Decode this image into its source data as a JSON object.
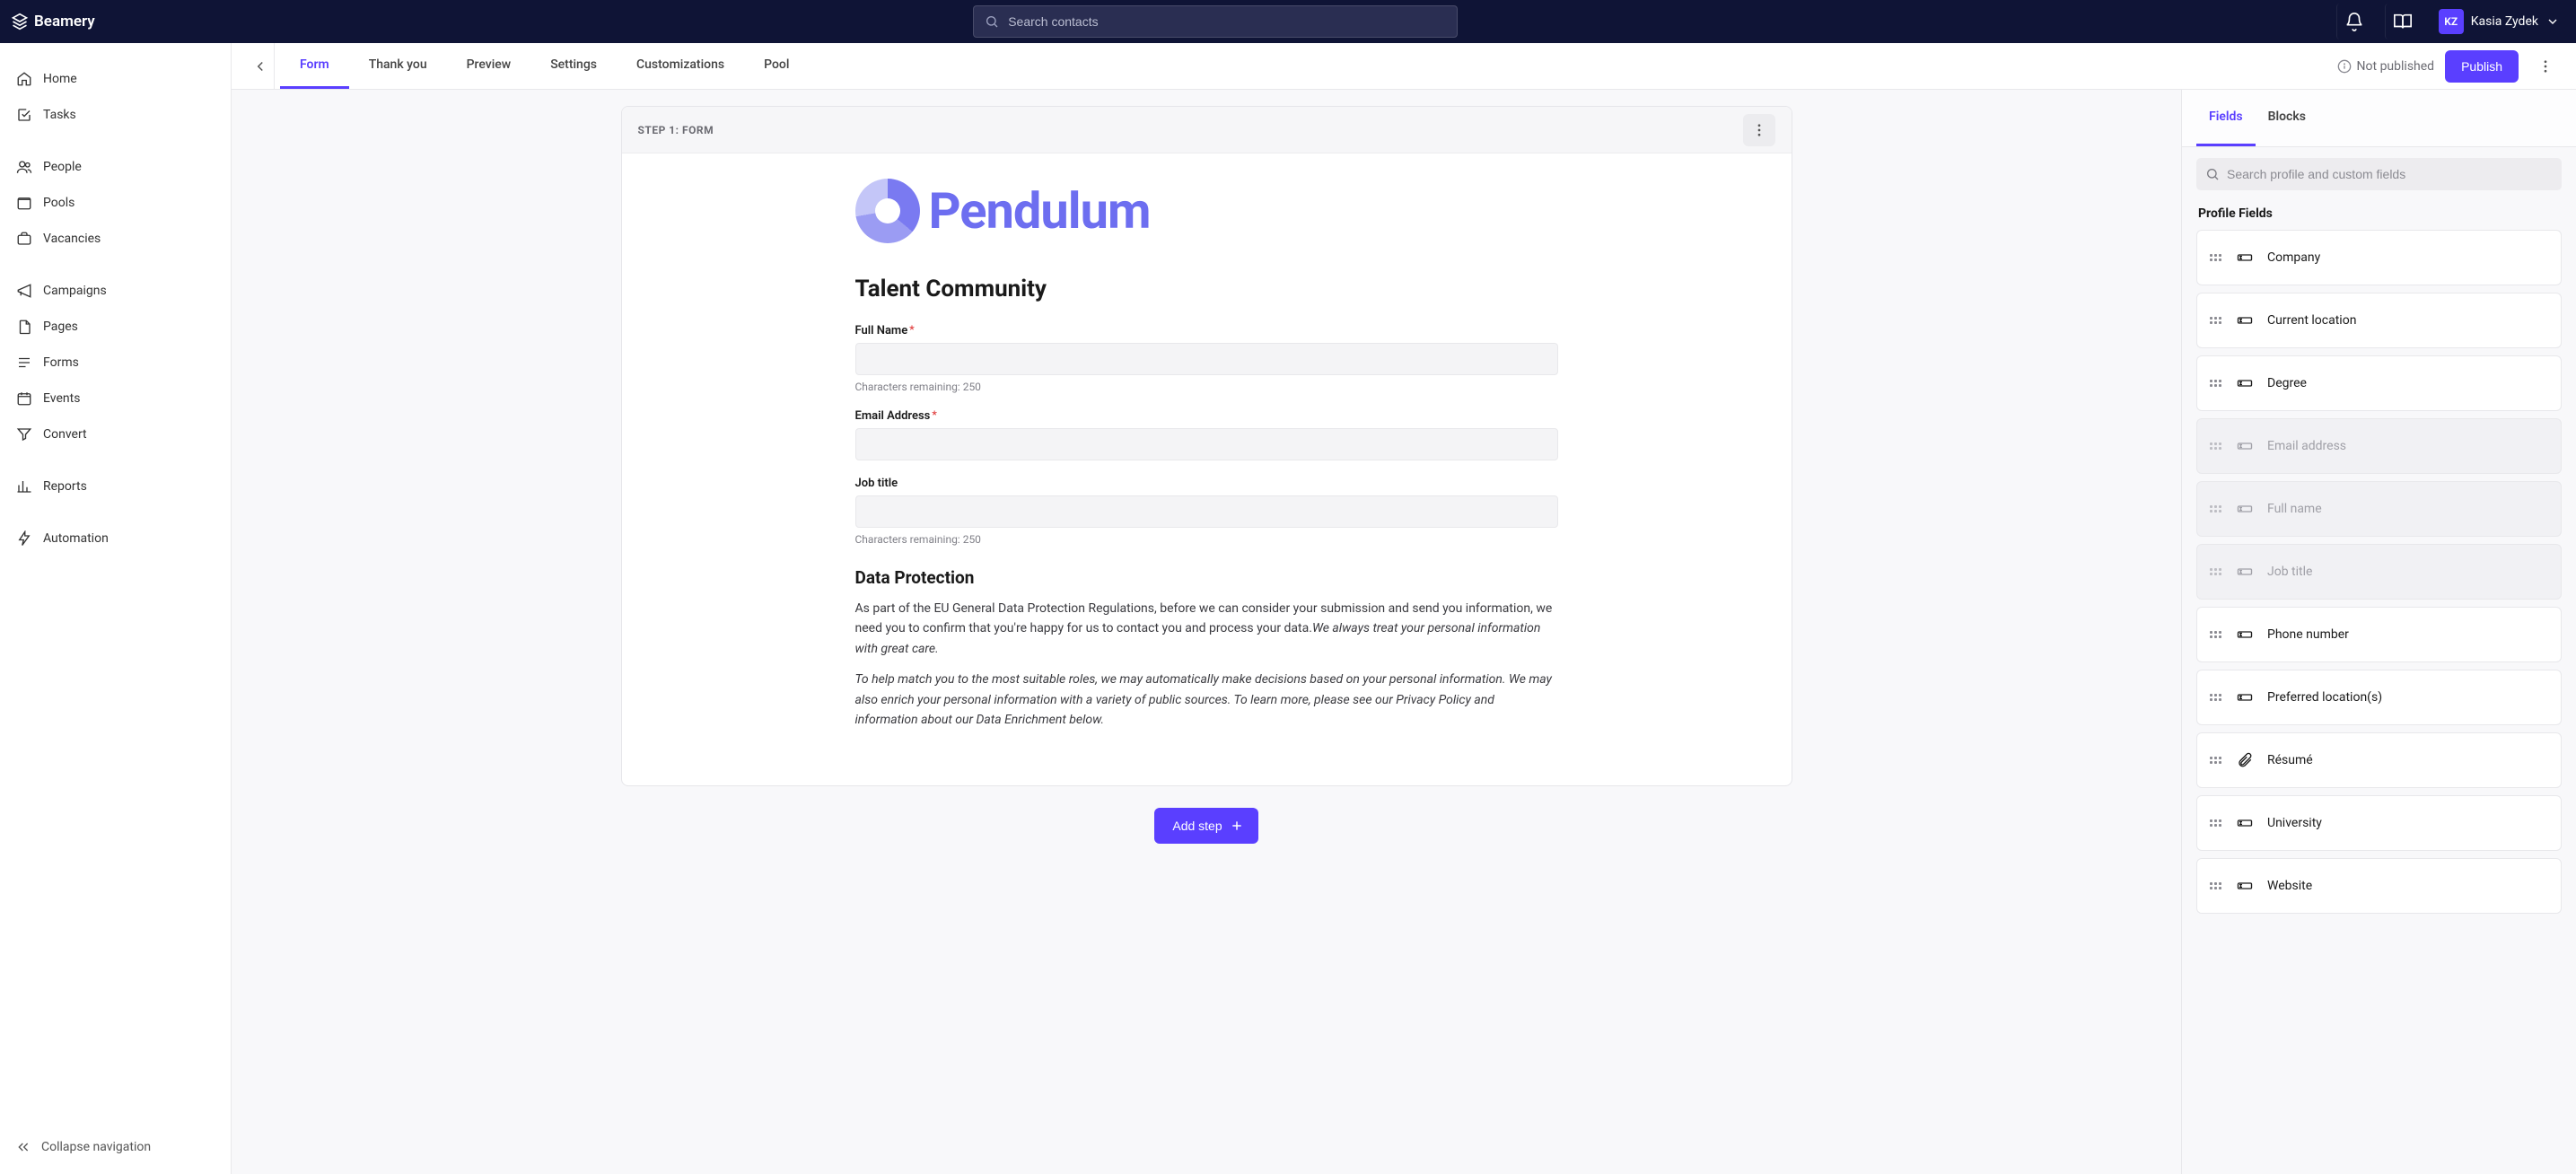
{
  "header": {
    "brand": "Beamery",
    "search_placeholder": "Search contacts",
    "user_initials": "KZ",
    "user_name": "Kasia Zydek"
  },
  "sidebar": {
    "items": [
      {
        "id": "home",
        "label": "Home"
      },
      {
        "id": "tasks",
        "label": "Tasks"
      },
      {
        "id": "people",
        "label": "People"
      },
      {
        "id": "pools",
        "label": "Pools"
      },
      {
        "id": "vacancies",
        "label": "Vacancies"
      },
      {
        "id": "campaigns",
        "label": "Campaigns"
      },
      {
        "id": "pages",
        "label": "Pages"
      },
      {
        "id": "forms",
        "label": "Forms"
      },
      {
        "id": "events",
        "label": "Events"
      },
      {
        "id": "convert",
        "label": "Convert"
      },
      {
        "id": "reports",
        "label": "Reports"
      },
      {
        "id": "automation",
        "label": "Automation"
      }
    ],
    "collapse_label": "Collapse navigation"
  },
  "tabs": {
    "items": [
      "Form",
      "Thank you",
      "Preview",
      "Settings",
      "Customizations",
      "Pool"
    ],
    "active": "Form",
    "status": "Not published",
    "publish_label": "Publish"
  },
  "form_step": {
    "label": "STEP 1: FORM",
    "brand_name": "Pendulum",
    "title": "Talent Community",
    "fields": [
      {
        "label": "Full Name",
        "required": true,
        "helper": "Characters remaining: 250"
      },
      {
        "label": "Email Address",
        "required": true,
        "helper": ""
      },
      {
        "label": "Job title",
        "required": false,
        "helper": "Characters remaining: 250"
      }
    ],
    "dp_heading": "Data Protection",
    "dp_para1_plain": "As part of the EU General Data Protection Regulations, before we can consider your submission and send you information, we need you to confirm that you're happy for us to contact you and process your data.",
    "dp_para1_italic": "We always treat your personal information with great care.",
    "dp_para2": "To help match you to the most suitable roles, we may automatically make decisions based on your personal information. We may also enrich your personal information with a variety of public sources. To learn more, please see our Privacy Policy and information about our Data Enrichment below.",
    "add_step_label": "Add step"
  },
  "right_panel": {
    "tabs": [
      "Fields",
      "Blocks"
    ],
    "active": "Fields",
    "search_placeholder": "Search profile and custom fields",
    "section_title": "Profile Fields",
    "fields": [
      {
        "label": "Company",
        "type": "text",
        "disabled": false
      },
      {
        "label": "Current location",
        "type": "text",
        "disabled": false
      },
      {
        "label": "Degree",
        "type": "text",
        "disabled": false
      },
      {
        "label": "Email address",
        "type": "text",
        "disabled": true
      },
      {
        "label": "Full name",
        "type": "text",
        "disabled": true
      },
      {
        "label": "Job title",
        "type": "text",
        "disabled": true
      },
      {
        "label": "Phone number",
        "type": "text",
        "disabled": false
      },
      {
        "label": "Preferred location(s)",
        "type": "text",
        "disabled": false
      },
      {
        "label": "Résumé",
        "type": "attachment",
        "disabled": false
      },
      {
        "label": "University",
        "type": "text",
        "disabled": false
      },
      {
        "label": "Website",
        "type": "text",
        "disabled": false
      }
    ]
  }
}
